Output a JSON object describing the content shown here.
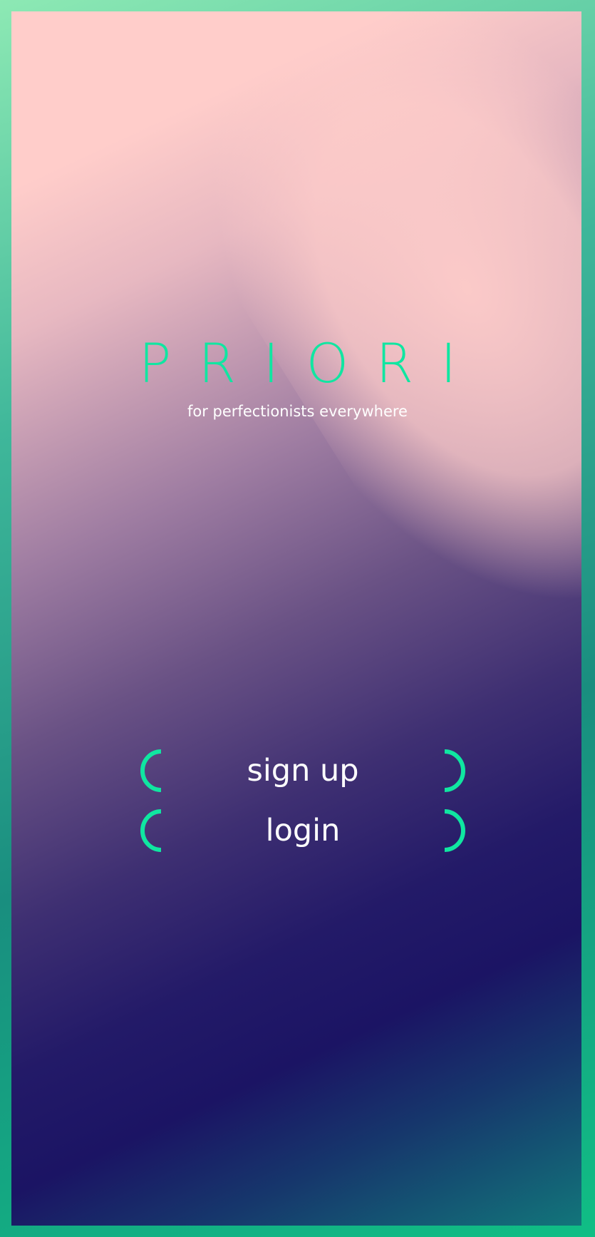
{
  "brand": {
    "name": "PRIORI",
    "tagline": "for perfectionists everywhere",
    "accent_color": "#10e6a1"
  },
  "actions": {
    "signup_label": "sign up",
    "login_label": "login"
  },
  "icons": {
    "bracket_left": "left-bracket-icon",
    "bracket_right": "right-bracket-icon"
  }
}
